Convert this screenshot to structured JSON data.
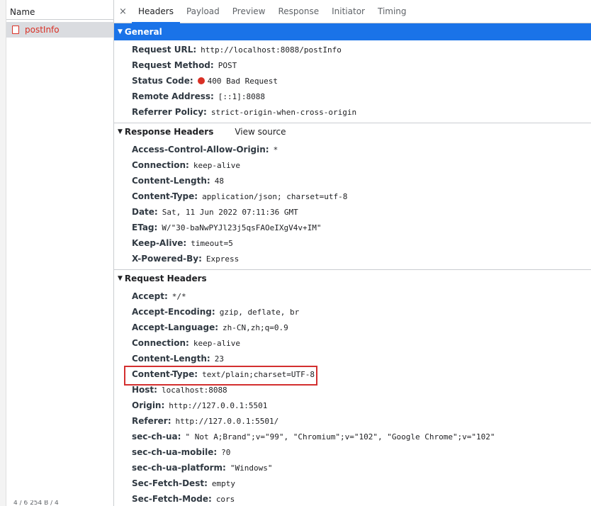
{
  "left_panel": {
    "column_header": "Name",
    "requests": [
      {
        "name": "postInfo"
      }
    ],
    "bottom_text": "4 / 6   254 B / 4"
  },
  "tabs": {
    "close_glyph": "×",
    "items": [
      "Headers",
      "Payload",
      "Preview",
      "Response",
      "Initiator",
      "Timing"
    ],
    "active": "Headers"
  },
  "general": {
    "title": "General",
    "rows": [
      {
        "key": "Request URL:",
        "value": "http://localhost:8088/postInfo"
      },
      {
        "key": "Request Method:",
        "value": "POST"
      },
      {
        "key": "Status Code:",
        "value": "400 Bad Request",
        "status_color": "#d93025"
      },
      {
        "key": "Remote Address:",
        "value": "[::1]:8088"
      },
      {
        "key": "Referrer Policy:",
        "value": "strict-origin-when-cross-origin"
      }
    ]
  },
  "response_headers": {
    "title": "Response Headers",
    "view_source": "View source",
    "rows": [
      {
        "key": "Access-Control-Allow-Origin:",
        "value": "*"
      },
      {
        "key": "Connection:",
        "value": "keep-alive"
      },
      {
        "key": "Content-Length:",
        "value": "48"
      },
      {
        "key": "Content-Type:",
        "value": "application/json; charset=utf-8"
      },
      {
        "key": "Date:",
        "value": "Sat, 11 Jun 2022 07:11:36 GMT"
      },
      {
        "key": "ETag:",
        "value": "W/\"30-baNwPYJl23j5qsFAOeIXgV4v+IM\""
      },
      {
        "key": "Keep-Alive:",
        "value": "timeout=5"
      },
      {
        "key": "X-Powered-By:",
        "value": "Express"
      }
    ]
  },
  "request_headers": {
    "title": "Request Headers",
    "rows": [
      {
        "key": "Accept:",
        "value": "*/*"
      },
      {
        "key": "Accept-Encoding:",
        "value": "gzip, deflate, br"
      },
      {
        "key": "Accept-Language:",
        "value": "zh-CN,zh;q=0.9"
      },
      {
        "key": "Connection:",
        "value": "keep-alive"
      },
      {
        "key": "Content-Length:",
        "value": "23"
      },
      {
        "key": "Content-Type:",
        "value": "text/plain;charset=UTF-8"
      },
      {
        "key": "Host:",
        "value": "localhost:8088"
      },
      {
        "key": "Origin:",
        "value": "http://127.0.0.1:5501"
      },
      {
        "key": "Referer:",
        "value": "http://127.0.0.1:5501/"
      },
      {
        "key": "sec-ch-ua:",
        "value": "\" Not A;Brand\";v=\"99\", \"Chromium\";v=\"102\", \"Google Chrome\";v=\"102\""
      },
      {
        "key": "sec-ch-ua-mobile:",
        "value": "?0"
      },
      {
        "key": "sec-ch-ua-platform:",
        "value": "\"Windows\""
      },
      {
        "key": "Sec-Fetch-Dest:",
        "value": "empty"
      },
      {
        "key": "Sec-Fetch-Mode:",
        "value": "cors"
      }
    ]
  },
  "colors": {
    "accent": "#1a73e8",
    "error": "#d93025",
    "highlight_box": "#d32f2f"
  }
}
